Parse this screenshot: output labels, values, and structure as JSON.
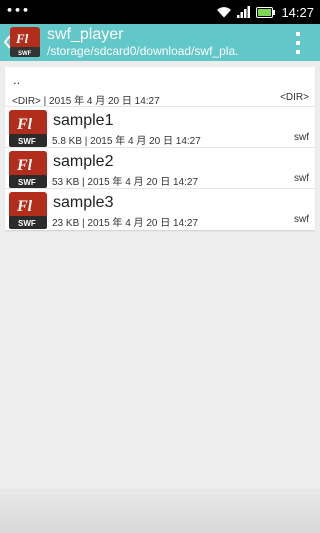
{
  "status_bar": {
    "notification_dots": "•••",
    "time": "14:27",
    "icons": [
      "wifi-icon",
      "signal-icon",
      "battery-icon"
    ]
  },
  "action_bar": {
    "title": "swf_player",
    "subtitle": "/storage/sdcard0/download/swf_pla.",
    "app_icon": "flash-app-icon",
    "app_icon_label": "Fl",
    "app_icon_sublabel": "SWF",
    "overflow_icon": "overflow-menu-icon",
    "color": "#62c7c8"
  },
  "list": {
    "parent": {
      "name": "..",
      "meta": "<DIR> | 2015 年 4 月 20 日 14:27",
      "type": "<DIR>"
    },
    "files": [
      {
        "name": "sample1",
        "meta": "5.8 KB | 2015 年 4 月 20 日 14:27",
        "type": "swf",
        "icon": "flash-swf-file-icon"
      },
      {
        "name": "sample2",
        "meta": "53 KB | 2015 年 4 月 20 日 14:27",
        "type": "swf",
        "icon": "flash-swf-file-icon"
      },
      {
        "name": "sample3",
        "meta": "23 KB | 2015 年 4 月 20 日 14:27",
        "type": "swf",
        "icon": "flash-swf-file-icon"
      }
    ],
    "file_icon_label": "Fl",
    "file_icon_sublabel": "SWF"
  }
}
